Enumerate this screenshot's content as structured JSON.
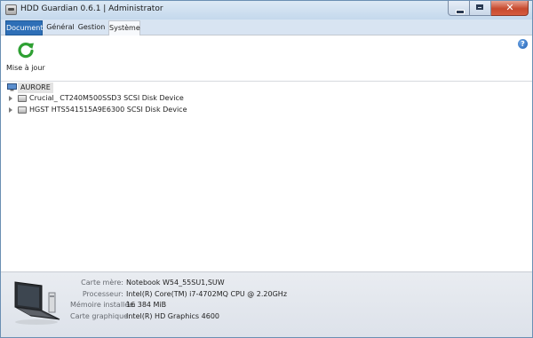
{
  "window": {
    "title": "HDD Guardian 0.6.1 | Administrator",
    "icon": "hard-drive-icon",
    "close_glyph": "✕"
  },
  "tabs": [
    {
      "label": "Document",
      "active": true
    },
    {
      "label": "Général",
      "active": false
    },
    {
      "label": "Gestion",
      "active": false
    },
    {
      "label": "Système",
      "active": false
    }
  ],
  "ribbon": {
    "refresh_label": "Mise à jour",
    "refresh_icon": "refresh-icon",
    "help_glyph": "?",
    "help_icon": "help-icon"
  },
  "tree": {
    "root": {
      "label": "AURORE",
      "icon": "computer-icon"
    },
    "disks": [
      {
        "label": "Crucial_ CT240M500SSD3 SCSI Disk Device",
        "icon": "hard-disk-icon"
      },
      {
        "label": "HGST HTS541515A9E6300 SCSI Disk Device",
        "icon": "hard-disk-icon"
      }
    ]
  },
  "system_info": {
    "icon": "laptop-icon",
    "rows": [
      {
        "label": "Carte mère:",
        "value": "Notebook W54_55SU1,SUW"
      },
      {
        "label": "Processeur:",
        "value": "Intel(R) Core(TM) i7-4702MQ CPU @ 2.20GHz"
      },
      {
        "label": "Mémoire installée:",
        "value": "16 384 MiB"
      },
      {
        "label": "Carte graphique:",
        "value": "Intel(R) HD Graphics 4600"
      }
    ]
  },
  "colors": {
    "active_tab": "#2e6fb7",
    "titlebar": "#c4d8ec",
    "close_button": "#c74a2e",
    "refresh_green": "#2ea033"
  }
}
